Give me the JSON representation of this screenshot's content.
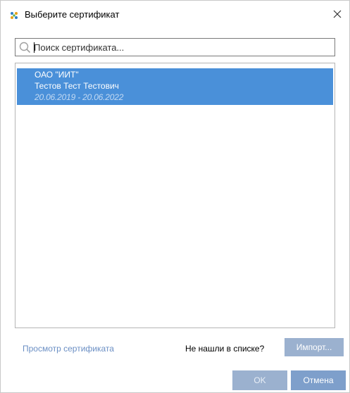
{
  "window": {
    "title": "Выберите сертификат",
    "close_glyph": "✕"
  },
  "search": {
    "placeholder": "Поиск сертификата...",
    "value": "",
    "icon": "search-icon"
  },
  "certificates": [
    {
      "org": "ОАО \"ИИТ\"",
      "owner": "Тестов Тест Тестович",
      "validity": "20.06.2019 - 20.06.2022",
      "selected": true
    }
  ],
  "footer": {
    "view_link": "Просмотр сертификата",
    "not_found_label": "Не нашли в списке?",
    "import_label": "Импорт...",
    "ok_label": "OK",
    "cancel_label": "Отмена"
  },
  "colors": {
    "selection": "#4a90d9",
    "button": "#9bb1cf",
    "link": "#6b8fc4"
  }
}
